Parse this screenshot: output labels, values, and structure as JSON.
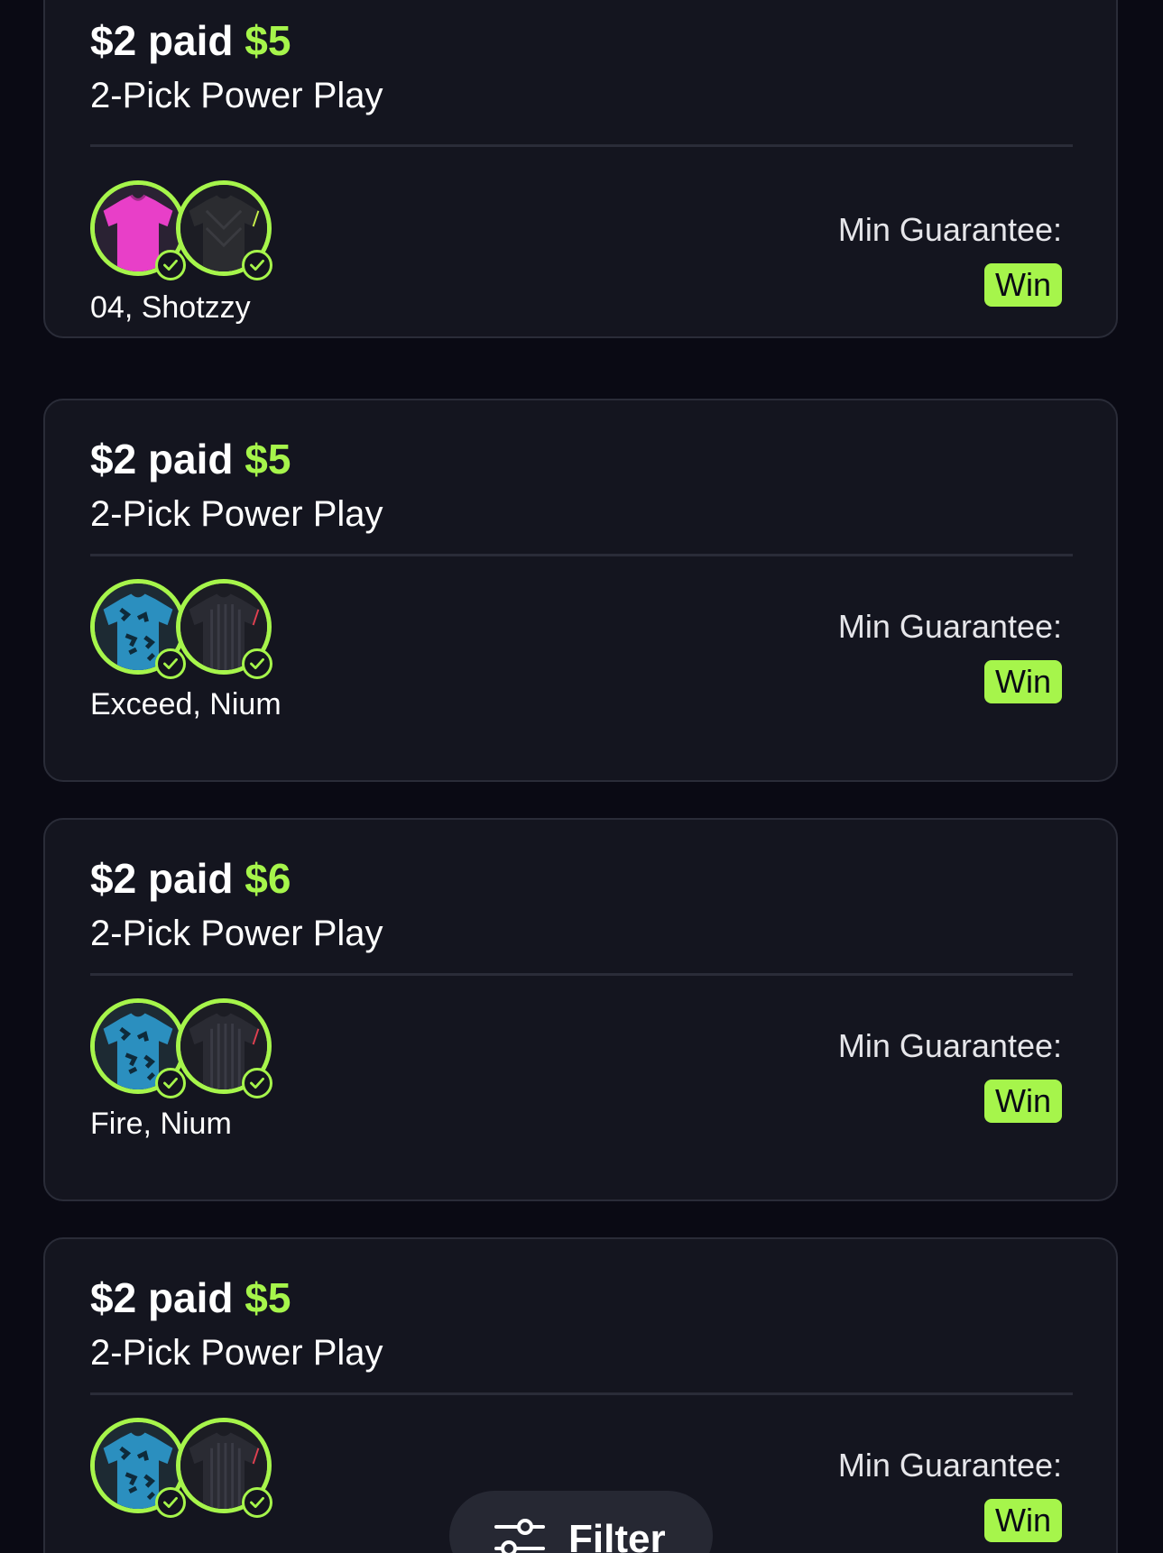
{
  "colors": {
    "background": "#0a0a14",
    "card": "#14151f",
    "accent": "#a6f54b",
    "text": "#ffffff"
  },
  "entries": [
    {
      "paid": "$2 paid",
      "won": "$5",
      "play_type": "2-Pick Power Play",
      "players": "04, Shotzzy",
      "min_label": "Min Guarantee:",
      "result": "Win",
      "jerseys": [
        "magenta-jersey",
        "black-jersey"
      ]
    },
    {
      "paid": "$2 paid",
      "won": "$5",
      "play_type": "2-Pick Power Play",
      "players": "Exceed, Nium",
      "min_label": "Min Guarantee:",
      "result": "Win",
      "jerseys": [
        "blue-camo-jersey",
        "dark-striped-jersey"
      ]
    },
    {
      "paid": "$2 paid",
      "won": "$6",
      "play_type": "2-Pick Power Play",
      "players": "Fire, Nium",
      "min_label": "Min Guarantee:",
      "result": "Win",
      "jerseys": [
        "blue-camo-jersey",
        "dark-striped-jersey"
      ]
    },
    {
      "paid": "$2 paid",
      "won": "$5",
      "play_type": "2-Pick Power Play",
      "players": "",
      "min_label": "Min Guarantee:",
      "result": "Win",
      "jerseys": [
        "blue-camo-jersey",
        "dark-striped-jersey"
      ]
    }
  ],
  "filter": {
    "label": "Filter",
    "icon": "sliders-icon"
  }
}
